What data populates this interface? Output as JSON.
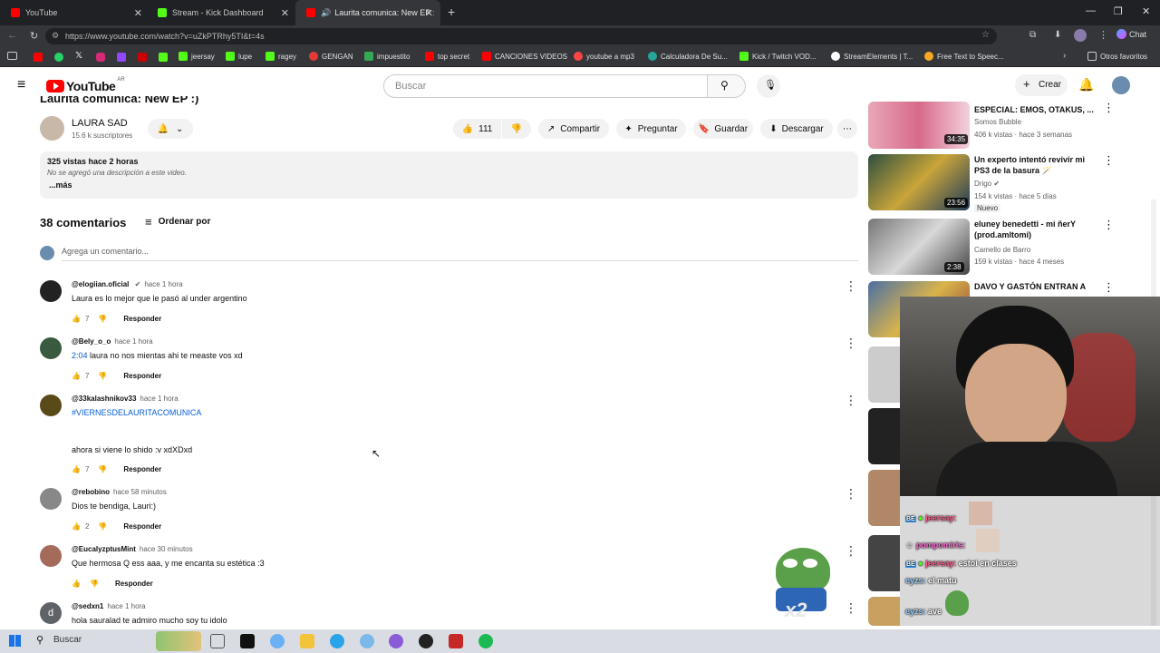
{
  "browser": {
    "tabs": [
      {
        "label": "YouTube",
        "color": "#ff0000"
      },
      {
        "label": "Stream - Kick Dashboard",
        "color": "#53fc18"
      },
      {
        "label": "Laurita comunica: New EP :) -",
        "color": "#ff0000"
      }
    ],
    "url": "https://www.youtube.com/watch?v=uZkPTRhy5TI&t=4s",
    "bookmarks": [
      "jeersay",
      "lupe",
      "ragey",
      "GENGAN",
      "impuestito",
      "top secret",
      "CANCIONES VIDEOS",
      "youtube a mp3",
      "Calculadora De Su...",
      "Kick / Twitch VOD...",
      "StreamElements | T...",
      "Free Text to Speec..."
    ],
    "other_bookmarks": "Otros favoritos",
    "chat_btn": "Chat"
  },
  "youtube": {
    "logo": "YouTube",
    "logo_region": "AR",
    "search_placeholder": "Buscar",
    "create_label": "Crear"
  },
  "video": {
    "title_partial": "Laurita comunica: New EP :)",
    "channel": "LAURA SAD",
    "subscribers": "15.6 k suscriptores",
    "likes": "111",
    "share": "Compartir",
    "ask": "Preguntar",
    "save": "Guardar",
    "download": "Descargar",
    "views_time": "325 vistas  hace 2 horas",
    "no_desc": "No se agregó una descripción a este video.",
    "more": "...más"
  },
  "comments": {
    "count": "38 comentarios",
    "sort": "Ordenar por",
    "add_placeholder": "Agrega un comentario...",
    "reply": "Responder",
    "items": [
      {
        "author": "@elogiian.oficial",
        "time": "hace 1 hora",
        "text": "Laura es lo mejor que le pasó al under argentino",
        "likes": "7"
      },
      {
        "author": "@Bely_o_o",
        "time": "hace 1 hora",
        "timestamp": "2:04",
        "text": "laura no nos mientas ahi te measte vos xd",
        "likes": "7"
      },
      {
        "author": "@33kalashnikov33",
        "time": "hace 1 hora",
        "hashtag": "#VIERNESDELAURITACOMUNICA",
        "text": "ahora si viene lo shido :v xdXDxd",
        "likes": "7"
      },
      {
        "author": "@rebobino",
        "time": "hace 58 minutos",
        "text": "Dios te bendiga, Lauri:)",
        "likes": "2"
      },
      {
        "author": "@EucalyzptusMint",
        "time": "hace 30 minutos",
        "text": "Que hermosa Q ess aaa, y me encanta su estética :3",
        "likes": ""
      },
      {
        "author": "@sedxn1",
        "time": "hace 1 hora",
        "text": "hola sauralad te admiro mucho soy tu idolo",
        "likes": ""
      }
    ]
  },
  "related": [
    {
      "title": "ESPECIAL: EMOS, OTAKUS, ...",
      "channel": "Somos Bubble",
      "meta": "406 k vistas · hace 3 semanas",
      "duration": "34:35"
    },
    {
      "title": "Un experto intentó revivir mi PS3 de la basura 🪄",
      "channel": "Drigo",
      "meta": "154 k vistas · hace 5 días",
      "badge": "Nuevo",
      "duration": "23:56"
    },
    {
      "title": "eluney benedetti - mi ñerY (prod.amltomi)",
      "channel": "Camello de Barro",
      "meta": "159 k vistas · hace 4 meses",
      "duration": "2:38"
    },
    {
      "title": "DAVO Y GASTÓN ENTRAN A",
      "channel": "",
      "meta": "",
      "duration": ""
    }
  ],
  "stream_chat": [
    {
      "user": "jeersay:",
      "msg": ""
    },
    {
      "user": "pompomiris:",
      "msg": ""
    },
    {
      "user": "jeersay:",
      "msg": "estoi en clases"
    },
    {
      "user": "eyzs:",
      "msg": "el matu"
    },
    {
      "user": "eyzs:",
      "msg": "ave"
    },
    {
      "user": "eyzs:",
      "msg": "ave"
    }
  ],
  "taskbar": {
    "search": "Buscar"
  }
}
